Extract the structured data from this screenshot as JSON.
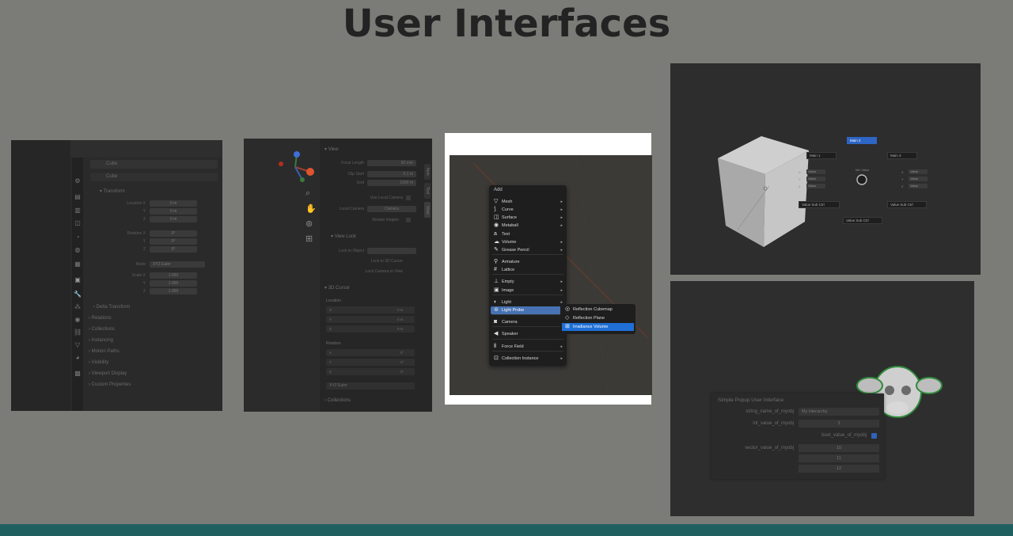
{
  "slide": {
    "title": "User Interfaces"
  },
  "colors": {
    "background": "#7b7b77",
    "title": "#232323",
    "accent": "#4772b3",
    "bottom_bar": "#1f5f5f"
  },
  "panel_properties": {
    "header_field": "Cube",
    "header_field2": "Cube",
    "section_transform": "Transform",
    "location_label": "Location X",
    "location_values": [
      "0 m",
      "0 m",
      "0 m"
    ],
    "rotation_label": "Rotation X",
    "rotation_values": [
      "0°",
      "0°",
      "0°"
    ],
    "mode_label": "Mode",
    "mode_value": "XYZ Euler",
    "scale_label": "Scale X",
    "scale_values": [
      "1.000",
      "1.000",
      "1.000"
    ],
    "axis_labels": [
      "Y",
      "Z"
    ],
    "delta_transform": "Delta Transform",
    "sections": [
      "Relations",
      "Collections",
      "Instancing",
      "Motion Paths",
      "Visibility",
      "Viewport Display",
      "Custom Properties"
    ]
  },
  "panel_view": {
    "section_view": "View",
    "focal_length_label": "Focal Length",
    "focal_length_value": "50 mm",
    "clip_start_label": "Clip Start",
    "clip_start_value": "0.1 m",
    "clip_end_label": "End",
    "clip_end_value": "1000 m",
    "use_local_camera": "Use Local Camera",
    "local_camera_label": "Local Camera",
    "local_camera_value": "Camera",
    "render_region": "Render Region",
    "section_view_lock": "View Lock",
    "lock_to_object": "Lock to Object",
    "lock_to_3d_cursor": "Lock to 3D Cursor",
    "lock_camera_to_view": "Lock Camera to View",
    "section_3d_cursor": "3D Cursor",
    "location_label": "Location",
    "rotation_label": "Rotation",
    "axis": [
      "X",
      "Y",
      "Z"
    ],
    "cursor_location_values": [
      "0 m",
      "0 m",
      "0 m"
    ],
    "cursor_rotation_values": [
      "0°",
      "0°",
      "0°"
    ],
    "rotation_mode": "XYZ Euler",
    "section_collections": "Collections",
    "side_tabs": [
      "Item",
      "Tool",
      "View"
    ]
  },
  "panel_add_menu": {
    "menu_title": "Add",
    "items": [
      {
        "label": "Mesh",
        "icon": "mesh-icon",
        "glyph": "▽",
        "submenu": true
      },
      {
        "label": "Curve",
        "icon": "curve-icon",
        "glyph": "⟆",
        "submenu": true
      },
      {
        "label": "Surface",
        "icon": "surface-icon",
        "glyph": "◫",
        "submenu": true
      },
      {
        "label": "Metaball",
        "icon": "metaball-icon",
        "glyph": "◉",
        "submenu": true
      },
      {
        "label": "Text",
        "icon": "text-icon",
        "glyph": "a",
        "submenu": false
      },
      {
        "label": "Volume",
        "icon": "volume-icon",
        "glyph": "☁",
        "submenu": true
      },
      {
        "label": "Grease Pencil",
        "icon": "grease-pencil-icon",
        "glyph": "✎",
        "submenu": true
      },
      {
        "label": "Armature",
        "icon": "armature-icon",
        "glyph": "⚲",
        "submenu": false
      },
      {
        "label": "Lattice",
        "icon": "lattice-icon",
        "glyph": "#",
        "submenu": false
      },
      {
        "label": "Empty",
        "icon": "empty-icon",
        "glyph": "⊥",
        "submenu": true
      },
      {
        "label": "Image",
        "icon": "image-icon",
        "glyph": "▣",
        "submenu": true
      },
      {
        "label": "Light",
        "icon": "light-icon",
        "glyph": "◐",
        "submenu": true
      },
      {
        "label": "Light Probe",
        "icon": "light-probe-icon",
        "glyph": "⊛",
        "submenu": true,
        "selected": true
      },
      {
        "label": "Camera",
        "icon": "camera-icon",
        "glyph": "◙",
        "submenu": false
      },
      {
        "label": "Speaker",
        "icon": "speaker-icon",
        "glyph": "◀",
        "submenu": false
      },
      {
        "label": "Force Field",
        "icon": "force-field-icon",
        "glyph": "⦀",
        "submenu": true
      },
      {
        "label": "Collection Instance",
        "icon": "collection-icon",
        "glyph": "⊡",
        "submenu": true
      }
    ],
    "submenu_items": [
      {
        "label": "Reflection Cubemap",
        "icon": "cubemap-icon",
        "glyph": "◎"
      },
      {
        "label": "Reflection Plane",
        "icon": "plane-icon",
        "glyph": "◇"
      },
      {
        "label": "Irradiance Volume",
        "icon": "irradiance-icon",
        "glyph": "⊞",
        "selected": true
      }
    ]
  },
  "panel_nodes": {
    "top_selected": "Main 2",
    "left_box": "Main 1",
    "right_box": "Main 3",
    "center_label": "Mix Value",
    "left_minis": [
      "Value",
      "Value",
      "Value"
    ],
    "right_minis": [
      "Value",
      "Value",
      "Value"
    ],
    "bottom_left": "Value Sub Ctrl",
    "bottom_center": "Value Sub Ctrl",
    "bottom_right": "Value Sub Ctrl",
    "left_axis": [
      "X",
      "Y",
      "Z"
    ],
    "right_axis": [
      "X",
      "Y",
      "Z"
    ]
  },
  "panel_popup": {
    "title": "Simple Popup User Interface",
    "string_label": "string_name_of_myobj",
    "string_value": "My Hierarchy",
    "int_label": "int_value_of_myobj",
    "int_value": "3",
    "bool_label": "bool_value_of_myobj",
    "vector_label": "vector_value_of_myobj",
    "vector_values": [
      "10",
      "11",
      "12"
    ]
  }
}
